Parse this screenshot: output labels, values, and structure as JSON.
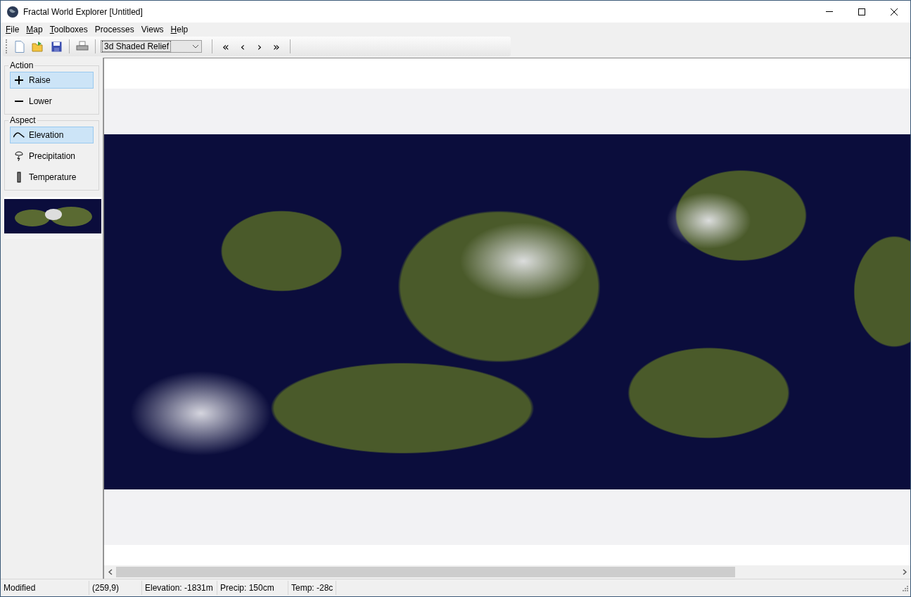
{
  "window": {
    "title": "Fractal World Explorer [Untitled]"
  },
  "menu": [
    {
      "label": "File",
      "underlined_first": true
    },
    {
      "label": "Map",
      "underlined_first": true
    },
    {
      "label": "Toolboxes",
      "underlined_first": true
    },
    {
      "label": "Processes",
      "underlined_first": false
    },
    {
      "label": "Views",
      "underlined_first": false
    },
    {
      "label": "Help",
      "underlined_first": true
    }
  ],
  "toolbar": {
    "view_select": {
      "value": "3d Shaded Relief"
    },
    "nav_buttons": [
      "«",
      "‹",
      "›",
      "»"
    ]
  },
  "sidebar": {
    "groups": [
      {
        "title": "Action",
        "items": [
          {
            "label": "Raise",
            "kind": "raise",
            "selected": true
          },
          {
            "label": "Lower",
            "kind": "lower",
            "selected": false
          }
        ]
      },
      {
        "title": "Aspect",
        "items": [
          {
            "label": "Elevation",
            "kind": "elevation",
            "selected": true
          },
          {
            "label": "Precipitation",
            "kind": "precipitation",
            "selected": false
          },
          {
            "label": "Temperature",
            "kind": "temperature",
            "selected": false
          }
        ]
      }
    ]
  },
  "status_bar": [
    "Modified",
    "(259,9)",
    "Elevation: -1831m",
    "Precip: 150cm",
    "Temp: -28c"
  ]
}
